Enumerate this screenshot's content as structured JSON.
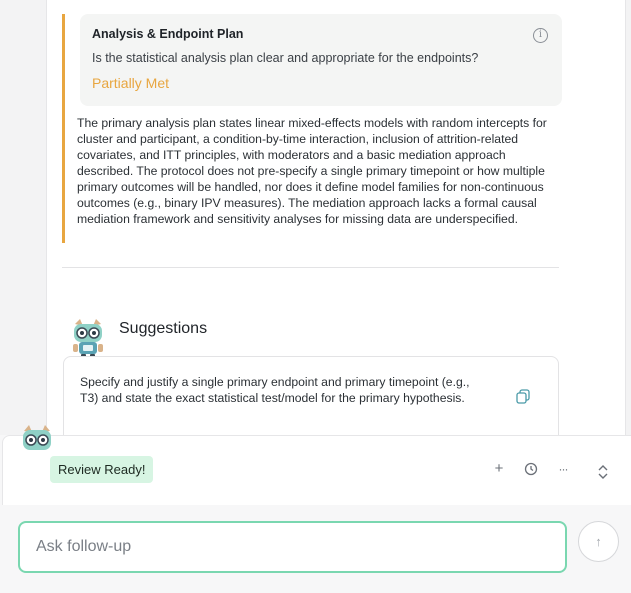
{
  "criterion": {
    "title": "Analysis & Endpoint Plan",
    "question": "Is the statistical analysis plan clear and appropriate for the endpoints?",
    "status": "Partially Met",
    "status_color": "#e8a640",
    "body": "The primary analysis plan states linear mixed-effects models with random intercepts for cluster and participant, a condition-by-time interaction, inclusion of attrition-related covariates, and ITT principles, with moderators and a basic mediation approach described. The protocol does not pre-specify a single primary timepoint or how multiple primary outcomes will be handled, nor does it define model families for non-continuous outcomes (e.g., binary IPV measures). The mediation approach lacks a formal causal mediation framework and sensitivity analyses for missing data are underspecified.",
    "info_icon": "info-icon"
  },
  "suggestions": {
    "title": "Suggestions",
    "items": [
      "Specify and justify a single primary endpoint and primary timepoint (e.g., T3) and state the exact statistical test/model for the primary hypothesis."
    ],
    "copy_icon": "copy-icon"
  },
  "review_bar": {
    "badge": "Review Ready!",
    "badge_color": "#d7f5e3",
    "tools": {
      "add": "+",
      "history": "clock-icon",
      "more": "···",
      "expand": "chevron-up-down-icon"
    }
  },
  "followup": {
    "placeholder": "Ask follow-up",
    "value": "",
    "border_color": "#7ad7b0",
    "send_icon": "arrow-up-icon"
  }
}
